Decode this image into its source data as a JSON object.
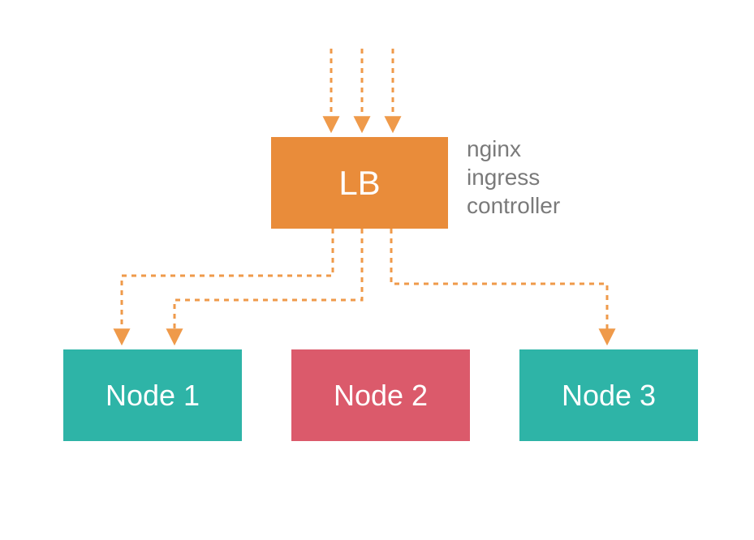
{
  "diagram": {
    "lb": {
      "label": "LB"
    },
    "side_label": {
      "line1": "nginx",
      "line2": "ingress",
      "line3": "controller"
    },
    "nodes": [
      {
        "label": "Node 1",
        "color": "#2eb4a7"
      },
      {
        "label": "Node 2",
        "color": "#db5a6b"
      },
      {
        "label": "Node 3",
        "color": "#2eb4a7"
      }
    ],
    "colors": {
      "lb": "#e98c3a",
      "arrow": "#ef9a4a",
      "node_up": "#2eb4a7",
      "node_down": "#db5a6b",
      "text_muted": "#7a7a7a"
    },
    "connections": {
      "incoming_arrows": 3,
      "lb_to": [
        "Node 1",
        "Node 1",
        "Node 3"
      ]
    }
  }
}
